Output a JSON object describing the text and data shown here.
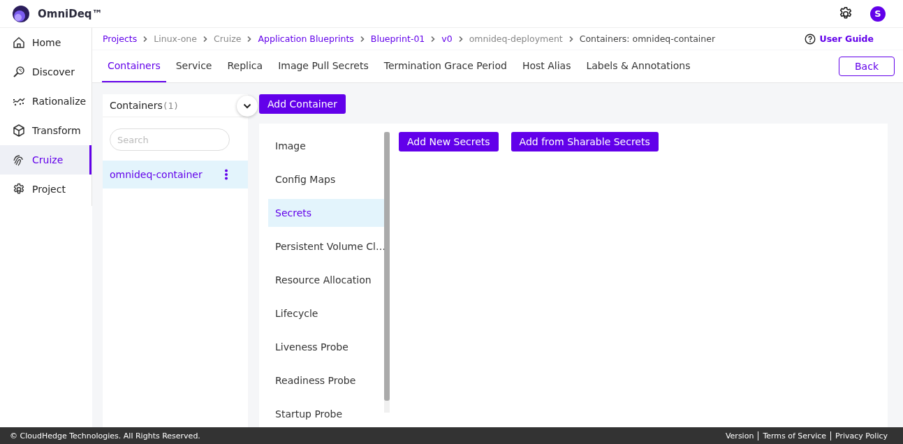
{
  "app": {
    "title": "OmniDeq™",
    "avatar": "S"
  },
  "sidebar": {
    "items": [
      {
        "label": "Home",
        "selected": false
      },
      {
        "label": "Discover",
        "selected": false
      },
      {
        "label": "Rationalize",
        "selected": false
      },
      {
        "label": "Transform",
        "selected": false
      },
      {
        "label": "Cruize",
        "selected": true
      },
      {
        "label": "Project",
        "selected": false
      }
    ]
  },
  "breadcrumb": [
    {
      "label": "Projects",
      "kind": "link"
    },
    {
      "label": "Linux-one",
      "kind": "text"
    },
    {
      "label": "Cruize",
      "kind": "text"
    },
    {
      "label": "Application Blueprints",
      "kind": "link"
    },
    {
      "label": "Blueprint-01",
      "kind": "link"
    },
    {
      "label": "v0",
      "kind": "link"
    },
    {
      "label": "omnideq-deployment",
      "kind": "text"
    },
    {
      "label": "Containers: omnideq-container",
      "kind": "current"
    }
  ],
  "user_guide": "User Guide",
  "tabs": [
    {
      "label": "Containers",
      "selected": true
    },
    {
      "label": "Service",
      "selected": false
    },
    {
      "label": "Replica",
      "selected": false
    },
    {
      "label": "Image Pull Secrets",
      "selected": false
    },
    {
      "label": "Termination Grace Period",
      "selected": false
    },
    {
      "label": "Host Alias",
      "selected": false
    },
    {
      "label": "Labels & Annotations",
      "selected": false
    }
  ],
  "back_button": "Back",
  "containers_panel": {
    "title": "Containers",
    "count": "(1)",
    "search": {
      "placeholder": "Search"
    },
    "items": [
      {
        "label": "omnideq-container",
        "selected": true
      }
    ]
  },
  "add_container_button": "Add Container",
  "sections": [
    {
      "label": "Image",
      "selected": false
    },
    {
      "label": "Config Maps",
      "selected": false
    },
    {
      "label": "Secrets",
      "selected": true
    },
    {
      "label": "Persistent Volume Cl…",
      "selected": false
    },
    {
      "label": "Resource Allocation",
      "selected": false
    },
    {
      "label": "Lifecycle",
      "selected": false
    },
    {
      "label": "Liveness Probe",
      "selected": false
    },
    {
      "label": "Readiness Probe",
      "selected": false
    },
    {
      "label": "Startup Probe",
      "selected": false
    }
  ],
  "actions": [
    "Add New Secrets",
    "Add from Sharable Secrets"
  ],
  "footer": {
    "copyright": "© CloudHedge Technologies. All Rights Reserved.",
    "links": [
      "Version",
      "Terms of Service",
      "Privacy Policy"
    ]
  }
}
